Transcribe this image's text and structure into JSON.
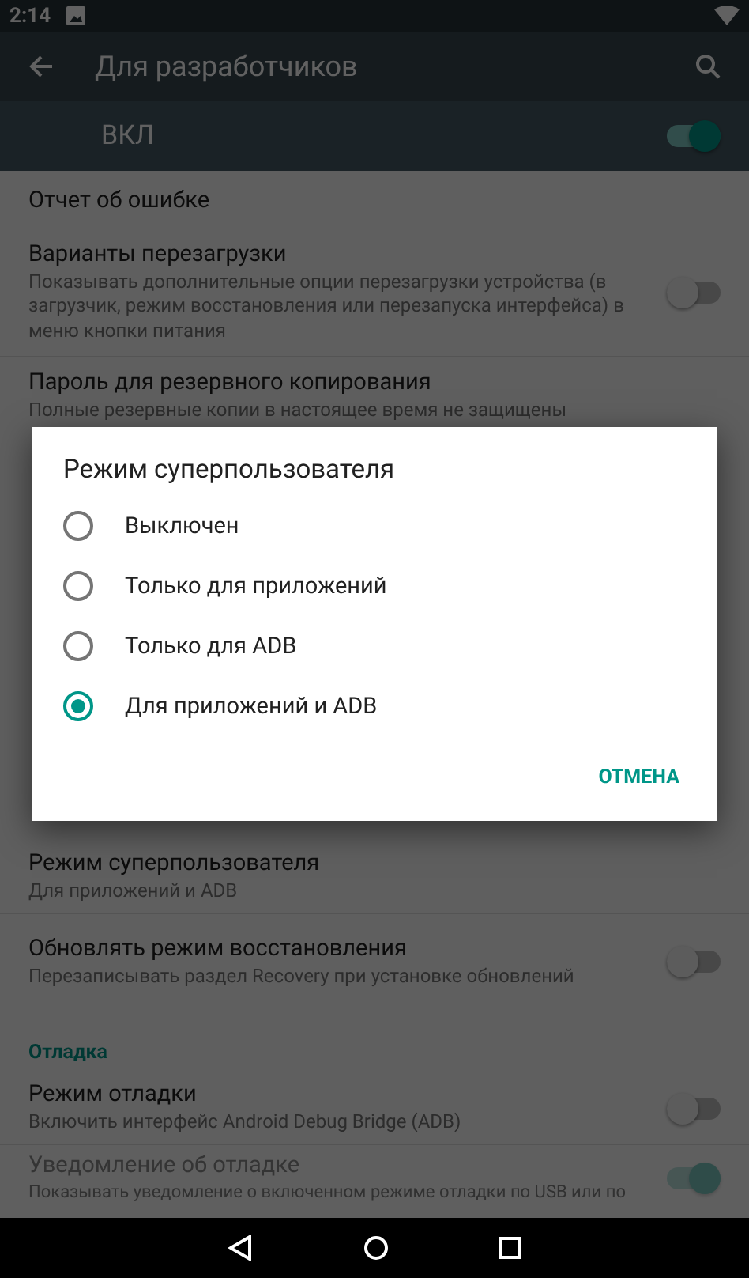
{
  "status_bar": {
    "time": "2:14"
  },
  "toolbar": {
    "title": "Для разработчиков"
  },
  "master_switch": {
    "label": "ВКЛ",
    "on": true
  },
  "settings": [
    {
      "kind": "item",
      "title": "Отчет об ошибке"
    },
    {
      "kind": "toggle",
      "title": "Варианты перезагрузки",
      "summary": "Показывать дополнительные опции перезагрузки устройства (в загрузчик, режим восстановления или перезапуска интерфейса) в меню кнопки питания",
      "on": false,
      "disabled": false
    },
    {
      "kind": "item",
      "title": "Пароль для резервного копирования",
      "summary": "Полные резервные копии в настоящее время не защищены"
    },
    {
      "kind": "hidden"
    },
    {
      "kind": "item",
      "title": "Режим суперпользователя",
      "summary": "Для приложений и ADB"
    },
    {
      "kind": "toggle",
      "title": "Обновлять режим восстановления",
      "summary": "Перезаписывать раздел Recovery при установке обновлений",
      "on": false,
      "disabled": false
    },
    {
      "kind": "header",
      "title": "Отладка"
    },
    {
      "kind": "toggle",
      "title": "Режим отладки",
      "summary": "Включить интерфейс Android Debug Bridge (ADB)",
      "on": false,
      "disabled": false
    },
    {
      "kind": "toggle",
      "title": "Уведомление об отладке",
      "summary": "Показывать уведомление о включенном режиме отладки по USB или по",
      "on": true,
      "disabled": true
    }
  ],
  "dialog": {
    "title": "Режим суперпользователя",
    "options": [
      {
        "label": "Выключен",
        "selected": false
      },
      {
        "label": "Только для приложений",
        "selected": false
      },
      {
        "label": "Только для ADB",
        "selected": false
      },
      {
        "label": "Для приложений и ADB",
        "selected": true
      }
    ],
    "buttons": [
      "ОТМЕНА"
    ]
  }
}
